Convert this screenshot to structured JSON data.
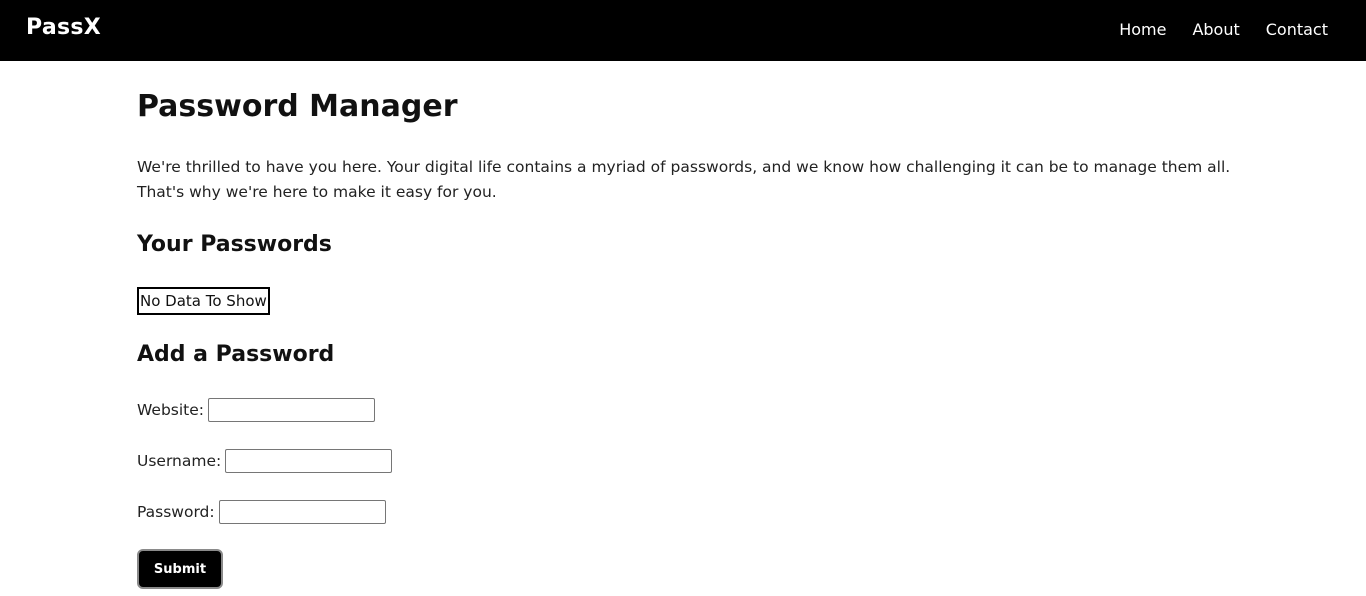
{
  "navbar": {
    "logo": "PassX",
    "links": [
      {
        "label": "Home"
      },
      {
        "label": "About"
      },
      {
        "label": "Contact"
      }
    ]
  },
  "main": {
    "title": "Password Manager",
    "intro": "We're thrilled to have you here. Your digital life contains a myriad of passwords, and we know how challenging it can be to manage them all. That's why we're here to make it easy for you.",
    "passwords_heading": "Your Passwords",
    "empty_message": "No Data To Show",
    "add_heading": "Add a Password",
    "form": {
      "website_label": "Website:",
      "website_value": "",
      "username_label": "Username:",
      "username_value": "",
      "password_label": "Password:",
      "password_value": "",
      "submit_label": "Submit"
    }
  },
  "colors": {
    "navbar_bg": "#000000",
    "nav_text": "#ffffff",
    "button_bg": "#000000",
    "page_bg": "#ffffff"
  }
}
